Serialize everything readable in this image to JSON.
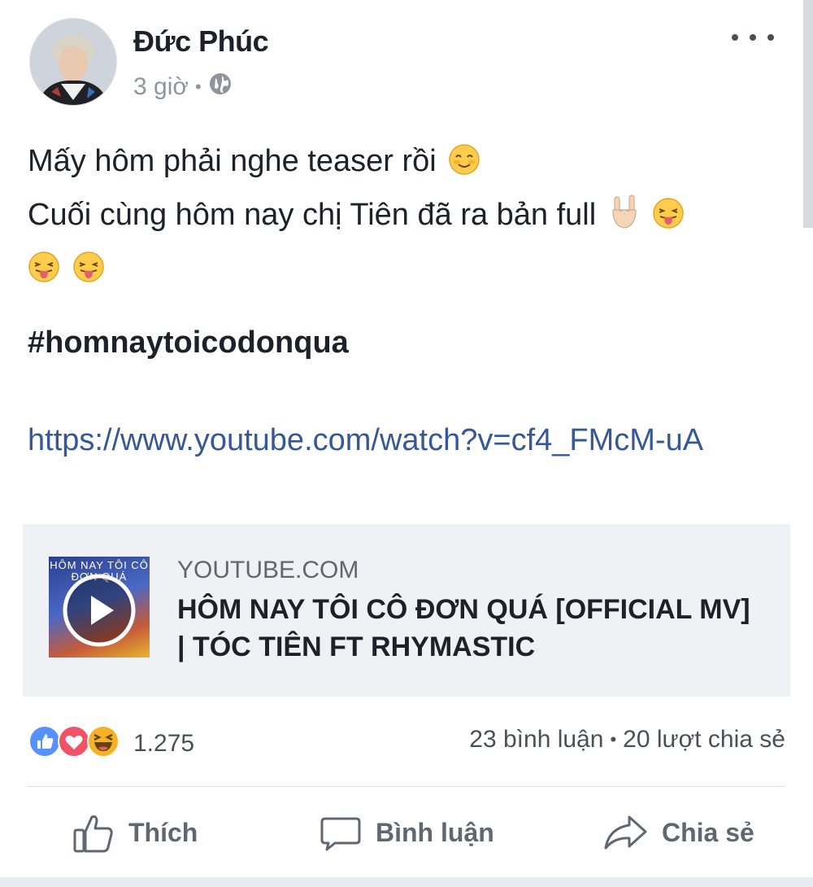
{
  "post": {
    "author": "Đức Phúc",
    "time": "3 giờ",
    "separator": "•",
    "privacy_icon": "globe-icon",
    "more_icon": "more-horizontal-icon",
    "text_line_1": "Mấy hôm phải nghe teaser rồi",
    "text_line_2": "Cuối cùng hôm nay chị Tiên đã ra bản full",
    "emojis": [
      "smiling-blush-emoji",
      "rock-on-hand-emoji",
      "tongue-out-emoji",
      "tongue-out-emoji",
      "tongue-out-emoji"
    ],
    "hashtag": "#homnaytoicodonqua",
    "link": "https://www.youtube.com/watch?v=cf4_FMcM-uA"
  },
  "preview": {
    "thumbnail_text": "HÔM NAY TÔI CÔ ĐƠN QUÁ",
    "domain": "YOUTUBE.COM",
    "title": "HÔM NAY TÔI CÔ ĐƠN QUÁ [OFFICIAL MV] | TÓC TIÊN FT RHYMASTIC"
  },
  "stats": {
    "reaction_icons": [
      "like-reaction-icon",
      "love-reaction-icon",
      "haha-reaction-icon"
    ],
    "reaction_count": "1.275",
    "comments": "23 bình luận",
    "separator": "•",
    "shares": "20 lượt chia sẻ"
  },
  "actions": {
    "like": "Thích",
    "comment": "Bình luận",
    "share": "Chia sẻ"
  },
  "colors": {
    "link": "#365899",
    "text": "#1d2129",
    "muted": "#90949c",
    "like_blue": "#5890ff",
    "love_red": "#f25268",
    "haha_yellow": "#f7b125",
    "preview_bg": "#f0f1f4"
  }
}
